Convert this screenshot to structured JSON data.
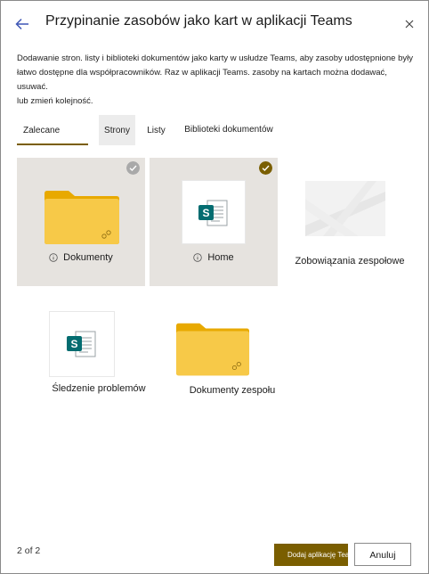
{
  "dialog": {
    "title": "Przypinanie zasobów jako kart w aplikacji Teams",
    "description_line1": "Dodawanie stron. listy i biblioteki dokumentów jako karty w usłudze Teams, aby zasoby udostępnione były",
    "description_line2": "łatwo dostępne dla współpracowników. Raz w aplikacji Teams. zasoby na kartach można dodawać, usuwać.",
    "description_line3": " lub zmień kolejność."
  },
  "tabs": [
    {
      "label": "Zalecane",
      "active": true
    },
    {
      "label": "Strony",
      "active": false
    },
    {
      "label": "Listy",
      "active": false
    },
    {
      "label": "Biblioteki dokumentów",
      "active": false
    }
  ],
  "tiles": [
    {
      "label": "Dokumenty",
      "selected": false,
      "icon": "folder-icon",
      "info": true
    },
    {
      "label": "Home",
      "selected": true,
      "icon": "sharepoint-page-icon",
      "info": true
    },
    {
      "label": "Zobowiązania zespołowe",
      "selected": false,
      "icon": "page-thumbnail",
      "info": false
    },
    {
      "label": "Śledzenie problemów",
      "selected": false,
      "icon": "sharepoint-list-icon",
      "info": false
    },
    {
      "label": "Dokumenty zespołu",
      "selected": false,
      "icon": "folder-icon",
      "info": false
    }
  ],
  "footer": {
    "page_indicator": "2 of 2",
    "primary_button": "Dodaj aplikację Teams",
    "secondary_button": "Anuluj"
  },
  "colors": {
    "accent": "#7a5e00",
    "tile_selected_bg": "#e6e3df",
    "folder": "#f7c948"
  }
}
